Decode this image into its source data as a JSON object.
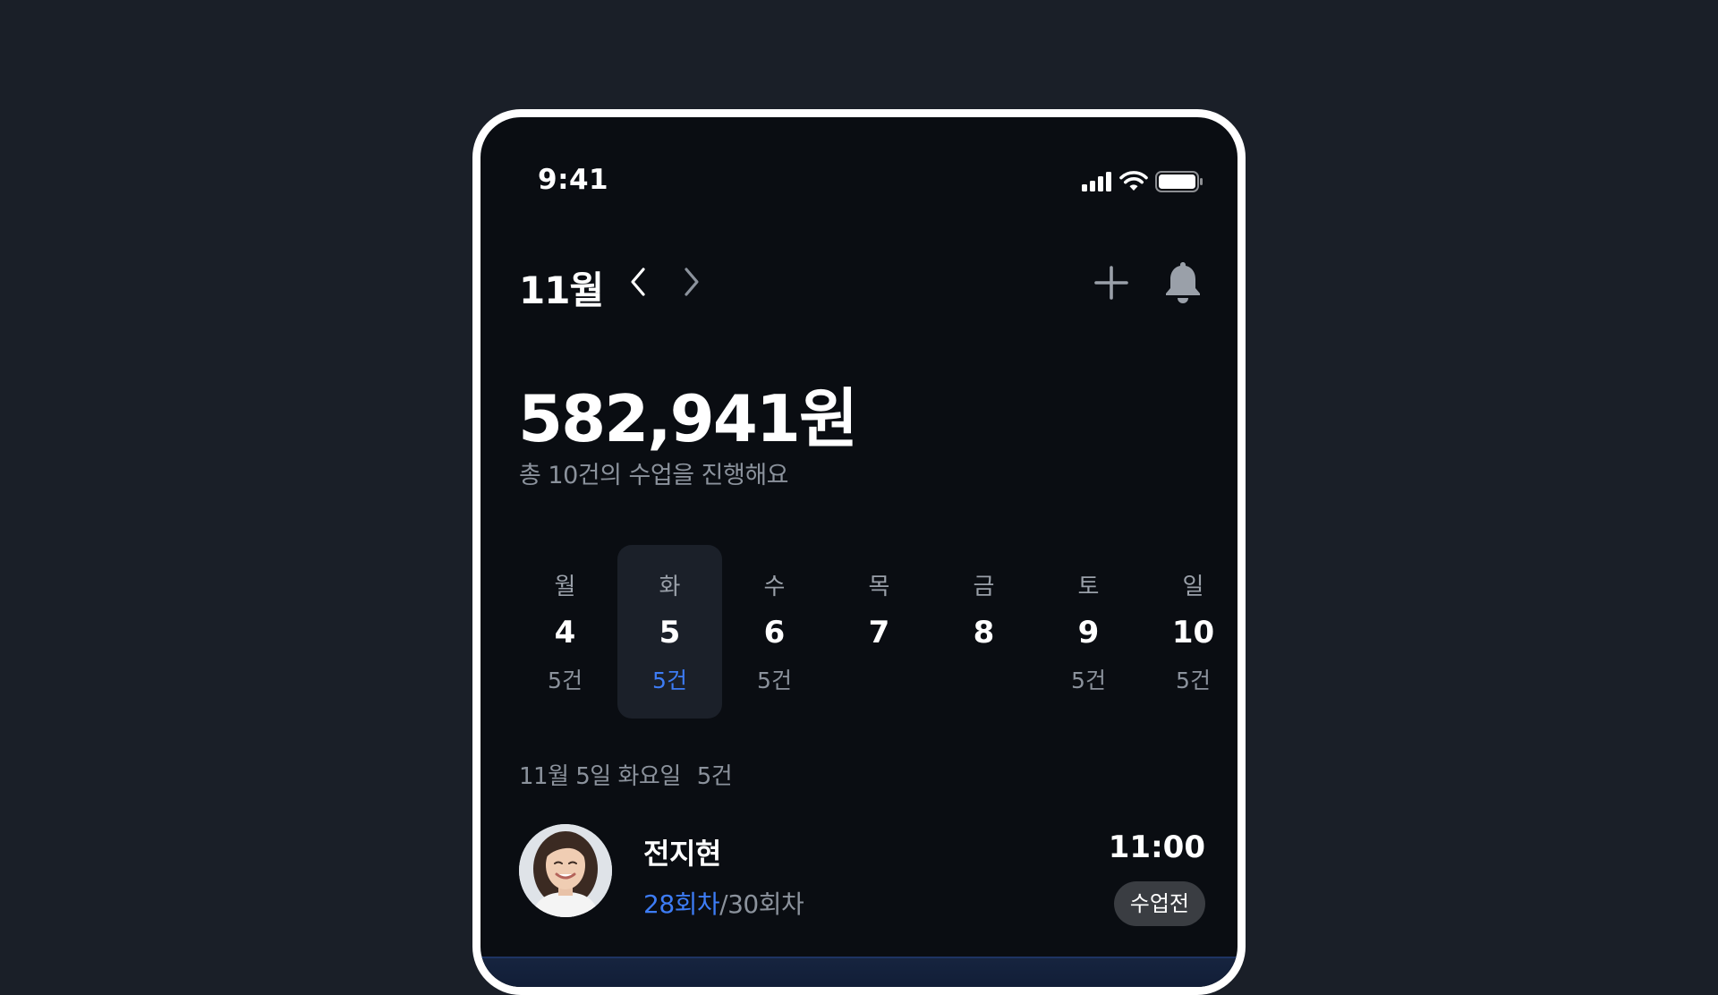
{
  "status_bar": {
    "time": "9:41"
  },
  "header": {
    "month": "11월"
  },
  "summary": {
    "amount": "582,941원",
    "description": "총 10건의 수업을 진행해요"
  },
  "week": [
    {
      "name": "월",
      "num": "4",
      "count": "5건"
    },
    {
      "name": "화",
      "num": "5",
      "count": "5건"
    },
    {
      "name": "수",
      "num": "6",
      "count": "5건"
    },
    {
      "name": "목",
      "num": "7",
      "count": ""
    },
    {
      "name": "금",
      "num": "8",
      "count": ""
    },
    {
      "name": "토",
      "num": "9",
      "count": "5건"
    },
    {
      "name": "일",
      "num": "10",
      "count": "5건"
    }
  ],
  "selected_day": "화",
  "schedule": {
    "date_label": "11월 5일 화요일",
    "count_label": "5건",
    "lessons": [
      {
        "name": "전지현",
        "session_current": "28회차",
        "session_total": "/30회차",
        "time": "11:00",
        "status": "수업전"
      }
    ]
  },
  "colors": {
    "accent": "#3d7cf5",
    "background": "#0a0d12",
    "outer": "#1a1f28",
    "muted": "#8b929c"
  }
}
